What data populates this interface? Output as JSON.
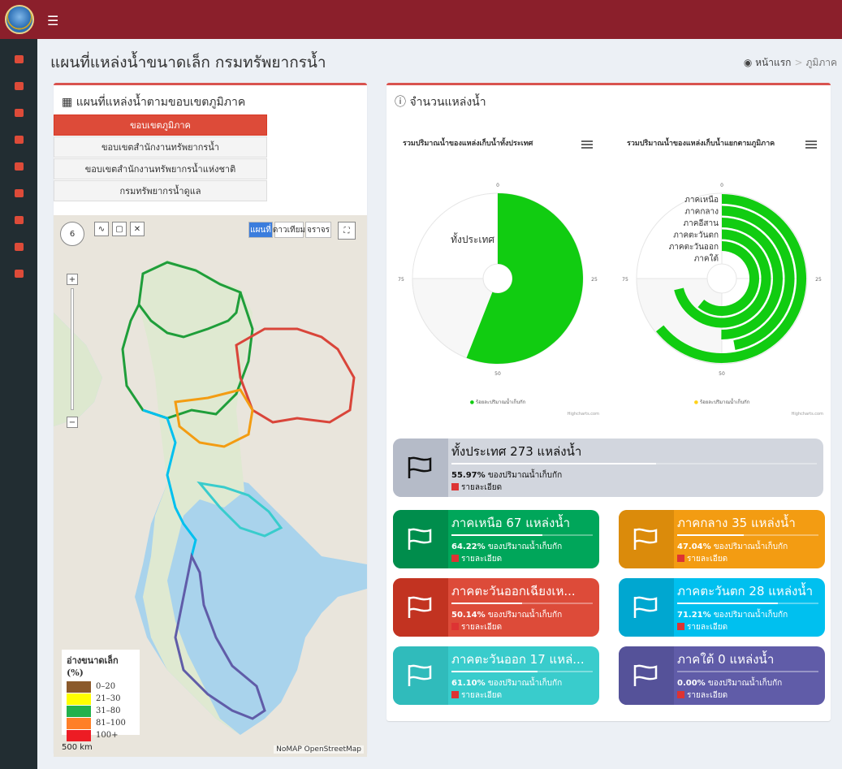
{
  "page": {
    "title": "แผนที่แหล่งน้ำขนาดเล็ก กรมทรัพยากรน้ำ",
    "breadcrumb": {
      "home": "หน้าแรก",
      "current": "ภูมิภาค"
    }
  },
  "map_box": {
    "title": "แผนที่แหล่งน้ำตามขอบเขตภูมิภาค",
    "tabs": [
      {
        "label": "ขอบเขตภูมิภาค",
        "active": true
      },
      {
        "label": "ขอบเขตสำนักงานทรัพยากรน้ำ",
        "active": false
      },
      {
        "label": "ขอบเขตสำนักงานทรัพยากรน้ำแห่งชาติ",
        "active": false
      },
      {
        "label": "กรมทรัพยากรน้ำดูแล",
        "active": false
      }
    ],
    "map_types": [
      "แผนที่",
      "ดาวเทียม",
      "จราจร"
    ],
    "zoom_level": "6",
    "legend": {
      "title": "อ่างขนาดเล็ก (%)",
      "items": [
        {
          "label": "0–20",
          "color": "#8b5a2b"
        },
        {
          "label": "21–30",
          "color": "#ffff00"
        },
        {
          "label": "31–80",
          "color": "#22b14c"
        },
        {
          "label": "81–100",
          "color": "#ff7f27"
        },
        {
          "label": "100+",
          "color": "#ed1c24"
        }
      ]
    },
    "scale": "500 km",
    "credit": "NoMAP OpenStreetMap"
  },
  "stats_box": {
    "title": "จำนวนแหล่งน้ำ",
    "charts": [
      {
        "title": "รวมปริมาณน้ำของแหล่งเก็บน้ำทั้งประเทศ",
        "legend": "ร้อยละปริมาณน้ำเก็บกัก",
        "credit": "Highcharts.com"
      },
      {
        "title": "รวมปริมาณน้ำของแหล่งเก็บน้ำแยกตามภูมิภาค",
        "legend": "ร้อยละปริมาณน้ำเก็บกัก",
        "credit": "Highcharts.com"
      }
    ],
    "cards": [
      {
        "name": "total",
        "head": "ทั้งประเทศ 273 แหล่งน้ำ",
        "pct_value": "55.97%",
        "pct_text": " ของปริมาณน้ำเก็บกัก",
        "fraction": 0.5597,
        "more": "รายละเอียด",
        "color": "#d2d6de",
        "icon_color": "#b5bbc8"
      },
      {
        "name": "north",
        "head": "ภาคเหนือ 67 แหล่งน้ำ",
        "pct_value": "64.22%",
        "pct_text": " ของปริมาณน้ำเก็บกัก",
        "fraction": 0.6422,
        "more": "รายละเอียด",
        "color": "#00a65a",
        "icon_color": "#008d4c"
      },
      {
        "name": "central",
        "head": "ภาคกลาง 35 แหล่งน้ำ",
        "pct_value": "47.04%",
        "pct_text": " ของปริมาณน้ำเก็บกัก",
        "fraction": 0.4704,
        "more": "รายละเอียด",
        "color": "#f39c12",
        "icon_color": "#db8b0b"
      },
      {
        "name": "northeast",
        "head": "ภาคตะวันออกเฉียงเห...",
        "pct_value": "50.14%",
        "pct_text": " ของปริมาณน้ำเก็บกัก",
        "fraction": 0.5014,
        "more": "รายละเอียด",
        "color": "#dd4b39",
        "icon_color": "#c23321"
      },
      {
        "name": "west",
        "head": "ภาคตะวันตก 28 แหล่งน้ำ",
        "pct_value": "71.21%",
        "pct_text": " ของปริมาณน้ำเก็บกัก",
        "fraction": 0.7121,
        "more": "รายละเอียด",
        "color": "#00c0ef",
        "icon_color": "#00a7d0"
      },
      {
        "name": "east",
        "head": "ภาคตะวันออก 17 แหล่...",
        "pct_value": "61.10%",
        "pct_text": " ของปริมาณน้ำเก็บกัก",
        "fraction": 0.611,
        "more": "รายละเอียด",
        "color": "#39cccc",
        "icon_color": "#30bbbb"
      },
      {
        "name": "south",
        "head": "ภาคใต้ 0 แหล่งน้ำ",
        "pct_value": "0.00%",
        "pct_text": " ของปริมาณน้ำเก็บกัก",
        "fraction": 0.0,
        "more": "รายละเอียด",
        "color": "#605ca8",
        "icon_color": "#555299"
      }
    ]
  },
  "chart_data": [
    {
      "type": "radial-bar",
      "title": "รวมปริมาณน้ำของแหล่งเก็บน้ำทั้งประเทศ",
      "categories": [
        "ทั้งประเทศ"
      ],
      "values": [
        55.97
      ],
      "ylim": [
        0,
        100
      ],
      "tick_labels": [
        "0",
        "25",
        "50",
        "75"
      ],
      "series": [
        {
          "name": "ร้อยละปริมาณน้ำเก็บกัก",
          "values": [
            55.97
          ],
          "color": "#11cc11"
        }
      ]
    },
    {
      "type": "radial-bar",
      "title": "รวมปริมาณน้ำของแหล่งเก็บน้ำแยกตามภูมิภาค",
      "categories": [
        "ภาคเหนือ",
        "ภาคกลาง",
        "ภาคอีสาน",
        "ภาคตะวันตก",
        "ภาคตะวันออก",
        "ภาคใต้"
      ],
      "values": [
        64.22,
        47.04,
        50.14,
        71.21,
        61.1,
        0.0
      ],
      "ylim": [
        0,
        100
      ],
      "tick_labels": [
        "0",
        "25",
        "50",
        "75"
      ],
      "series": [
        {
          "name": "ร้อยละปริมาณน้ำเก็บกัก",
          "values": [
            64.22,
            47.04,
            50.14,
            71.21,
            61.1,
            0.0
          ],
          "color": "#11cc11"
        }
      ]
    }
  ]
}
